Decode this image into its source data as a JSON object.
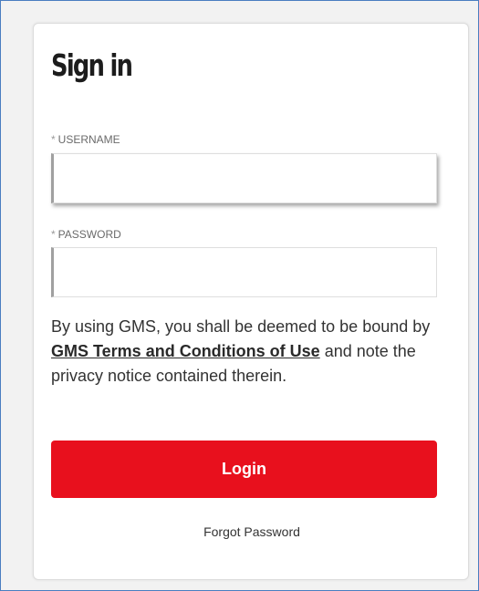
{
  "form": {
    "title": "Sign in",
    "username": {
      "required_marker": "*",
      "label": "USERNAME",
      "value": "",
      "placeholder": ""
    },
    "password": {
      "required_marker": "*",
      "label": "PASSWORD",
      "value": "",
      "placeholder": ""
    },
    "terms": {
      "prefix": "By using GMS, you shall be deemed to be bound by ",
      "link": "GMS Terms and Conditions of Use",
      "suffix": " and note the privacy notice contained therein."
    },
    "login_label": "Login",
    "forgot_label": "Forgot Password"
  },
  "colors": {
    "accent": "#e8101d",
    "frame_border": "#4a7dc0",
    "background": "#f2f2f2"
  }
}
